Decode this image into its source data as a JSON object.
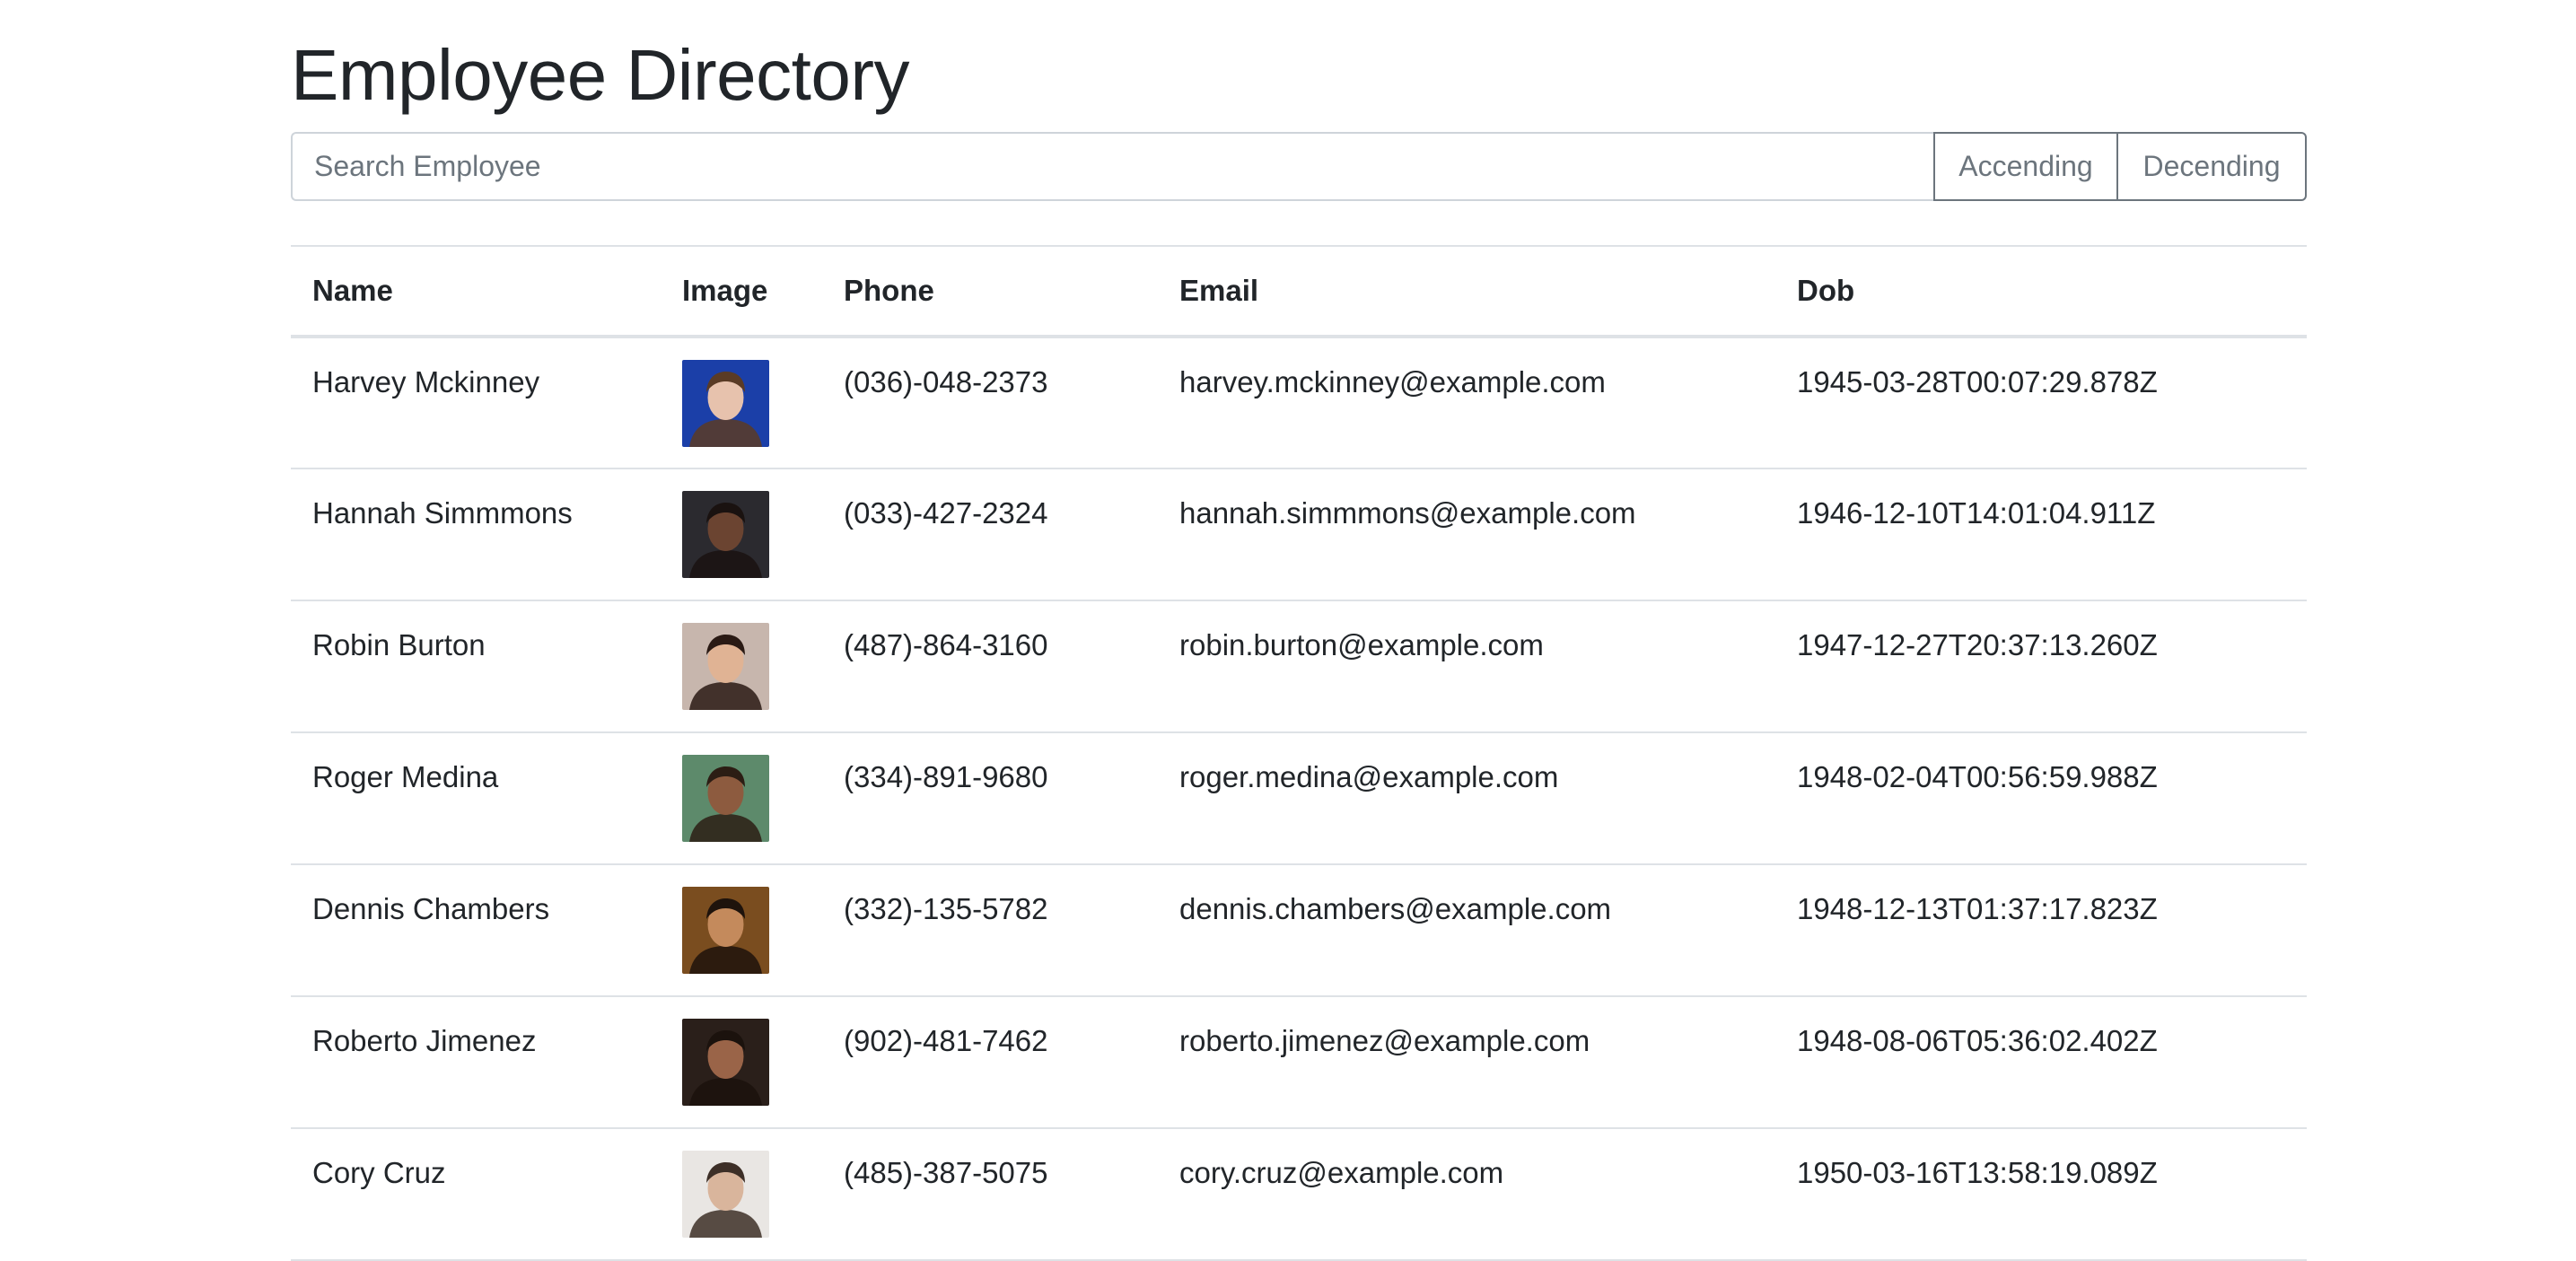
{
  "page": {
    "title": "Employee Directory"
  },
  "search": {
    "placeholder": "Search Employee",
    "value": ""
  },
  "sort": {
    "ascending_label": "Accending",
    "descending_label": "Decending"
  },
  "table": {
    "headers": {
      "name": "Name",
      "image": "Image",
      "phone": "Phone",
      "email": "Email",
      "dob": "Dob"
    },
    "rows": [
      {
        "name": "Harvey Mckinney",
        "phone": "(036)-048-2373",
        "email": "harvey.mckinney@example.com",
        "dob": "1945-03-28T00:07:29.878Z",
        "avatar_bg": "#1b3fa8",
        "avatar_skin": "#e7c2ad",
        "avatar_hair": "#5a3b25"
      },
      {
        "name": "Hannah Simmmons",
        "phone": "(033)-427-2324",
        "email": "hannah.simmmons@example.com",
        "dob": "1946-12-10T14:01:04.911Z",
        "avatar_bg": "#2b2a2f",
        "avatar_skin": "#6b4431",
        "avatar_hair": "#1a1210"
      },
      {
        "name": "Robin Burton",
        "phone": "(487)-864-3160",
        "email": "robin.burton@example.com",
        "dob": "1947-12-27T20:37:13.260Z",
        "avatar_bg": "#c7b6ad",
        "avatar_skin": "#e0b394",
        "avatar_hair": "#2a1a14"
      },
      {
        "name": "Roger Medina",
        "phone": "(334)-891-9680",
        "email": "roger.medina@example.com",
        "dob": "1948-02-04T00:56:59.988Z",
        "avatar_bg": "#5d8a6b",
        "avatar_skin": "#8d5b3f",
        "avatar_hair": "#2c1d14"
      },
      {
        "name": "Dennis Chambers",
        "phone": "(332)-135-5782",
        "email": "dennis.chambers@example.com",
        "dob": "1948-12-13T01:37:17.823Z",
        "avatar_bg": "#7a4d1f",
        "avatar_skin": "#c48a5c",
        "avatar_hair": "#1e130c"
      },
      {
        "name": "Roberto Jimenez",
        "phone": "(902)-481-7462",
        "email": "roberto.jimenez@example.com",
        "dob": "1948-08-06T05:36:02.402Z",
        "avatar_bg": "#2a1f1a",
        "avatar_skin": "#9a6448",
        "avatar_hair": "#1b120d"
      },
      {
        "name": "Cory Cruz",
        "phone": "(485)-387-5075",
        "email": "cory.cruz@example.com",
        "dob": "1950-03-16T13:58:19.089Z",
        "avatar_bg": "#e9e6e3",
        "avatar_skin": "#d9b59c",
        "avatar_hair": "#3d2f27"
      }
    ]
  }
}
